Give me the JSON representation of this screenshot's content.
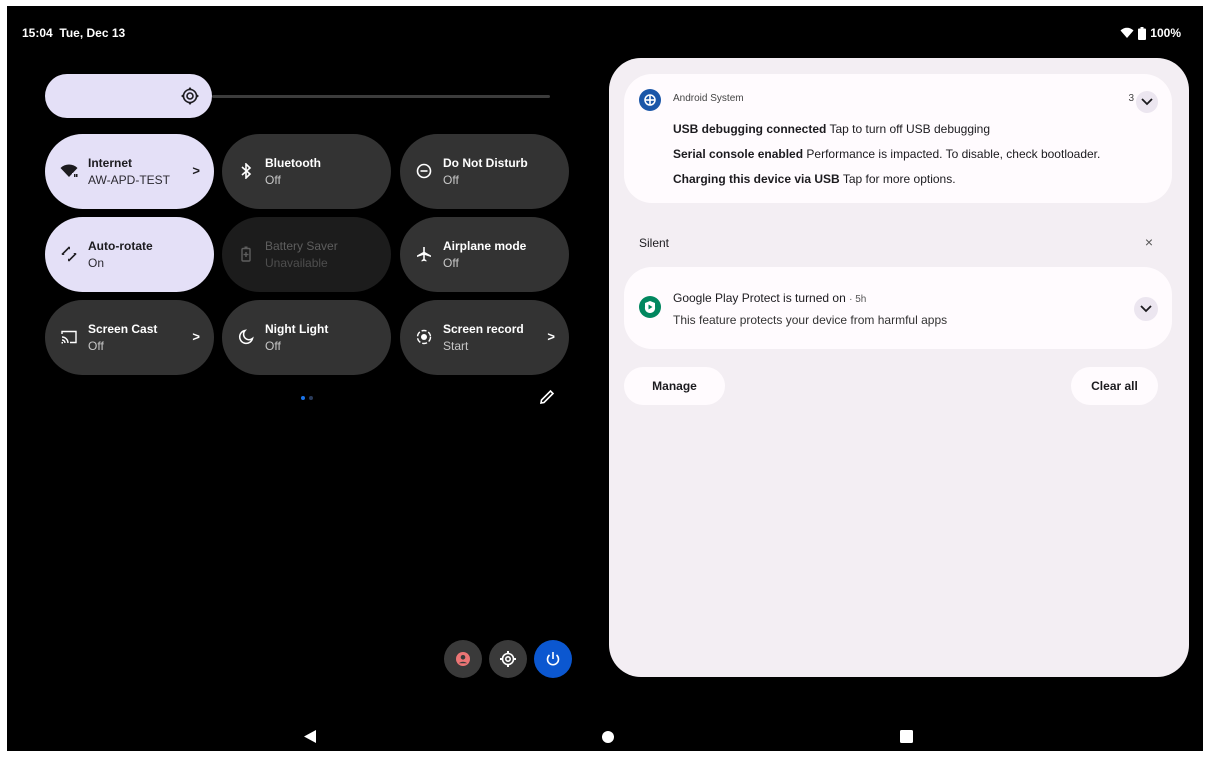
{
  "status": {
    "time": "15:04",
    "date": "Tue, Dec 13",
    "battery": "100%"
  },
  "brightness": {
    "level": 0.33
  },
  "tiles": [
    {
      "label": "Internet",
      "sub": "AW-APD-TEST",
      "state": "active",
      "chevron": ">",
      "icon": "wifi-icon"
    },
    {
      "label": "Bluetooth",
      "sub": "Off",
      "state": "off",
      "icon": "bluetooth-icon"
    },
    {
      "label": "Do Not Disturb",
      "sub": "Off",
      "state": "off",
      "icon": "do-not-disturb-icon"
    },
    {
      "label": "Auto-rotate",
      "sub": "On",
      "state": "active",
      "icon": "auto-rotate-icon"
    },
    {
      "label": "Battery Saver",
      "sub": "Unavailable",
      "state": "disabled",
      "icon": "battery-saver-icon"
    },
    {
      "label": "Airplane mode",
      "sub": "Off",
      "state": "off",
      "icon": "airplane-icon"
    },
    {
      "label": "Screen Cast",
      "sub": "Off",
      "state": "off",
      "chevron": ">",
      "icon": "cast-icon"
    },
    {
      "label": "Night Light",
      "sub": "Off",
      "state": "off",
      "icon": "night-light-icon"
    },
    {
      "label": "Screen record",
      "sub": "Start",
      "state": "off",
      "chevron": ">",
      "icon": "screen-record-icon"
    }
  ],
  "notifications": {
    "system": {
      "app": "Android System",
      "count": "3",
      "lines": [
        {
          "bold": "USB debugging connected",
          "text": "Tap to turn off USB debugging"
        },
        {
          "bold": "Serial console enabled",
          "text": "Performance is impacted. To disable, check bootloader."
        },
        {
          "bold": "Charging this device via USB",
          "text": "Tap for more options."
        }
      ]
    },
    "silent_header": "Silent",
    "silent_close": "×",
    "play_protect": {
      "title": "Google Play Protect is turned on",
      "age": "5h",
      "body": "This feature protects your device from harmful apps"
    },
    "manage": "Manage",
    "clear_all": "Clear all"
  },
  "colors": {
    "accent": "#e4e0f7",
    "tile": "#333333",
    "power": "#0b57d0",
    "user": "#ec7575",
    "play": "#01875f"
  }
}
